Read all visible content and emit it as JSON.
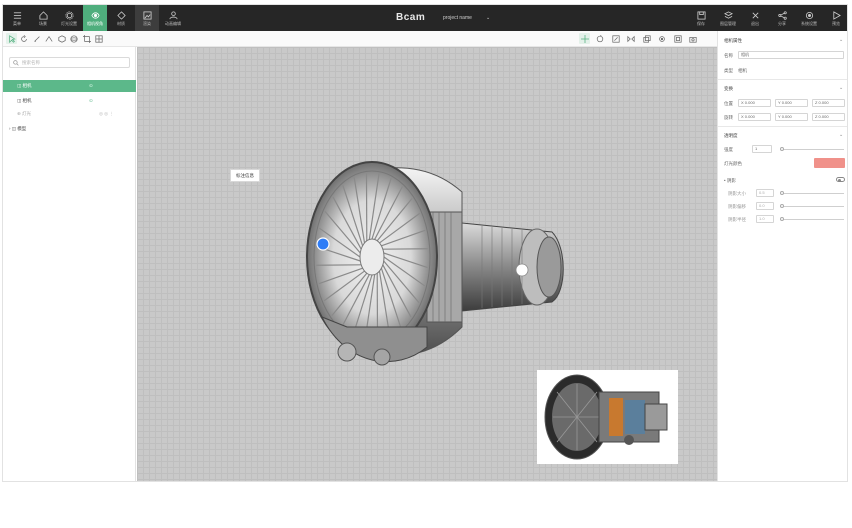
{
  "topbar": {
    "left_buttons": [
      {
        "label": "菜单",
        "icon": "menu-icon"
      },
      {
        "label": "场景",
        "icon": "home-icon"
      },
      {
        "label": "灯光设置",
        "icon": "gear-icon"
      },
      {
        "label": "相机视角",
        "icon": "eye-icon",
        "active": true
      },
      {
        "label": "材质",
        "icon": "palette-icon"
      },
      {
        "label": "渲染",
        "icon": "image-icon"
      },
      {
        "label": "动画编辑",
        "icon": "user-icon"
      }
    ],
    "brand": "Bcam",
    "project_name": "project name",
    "project_caret": "⌄",
    "right_buttons": [
      {
        "label": "保存",
        "icon": "save-icon"
      },
      {
        "label": "图层管理",
        "icon": "layers-icon"
      },
      {
        "label": "退出",
        "icon": "cross-icon"
      },
      {
        "label": "分享",
        "icon": "share-icon"
      },
      {
        "label": "系统设置",
        "icon": "settings-icon"
      },
      {
        "label": "预览",
        "icon": "play-icon"
      }
    ]
  },
  "toolbar": {
    "left_tools": [
      "select-icon",
      "rotate-icon",
      "pen-icon",
      "measure-icon",
      "box-icon",
      "sphere-icon",
      "crop-icon",
      "grid-icon"
    ],
    "right_tools": [
      "move-icon",
      "rotate-tool-icon",
      "scale-icon",
      "mirror-icon",
      "copy-icon",
      "settings-tool-icon",
      "frame-icon",
      "camera-icon"
    ]
  },
  "left_panel": {
    "search_placeholder": "搜索名称",
    "tree": [
      {
        "label": "◫ 相机",
        "eye": "⊙",
        "selected": true
      },
      {
        "label": "◫ 相机",
        "eye": "⊙",
        "selected": false
      },
      {
        "label": "⊕ 灯光",
        "eye": "◎ ◎ ⋮",
        "selected": false,
        "muted": true
      },
      {
        "label": "›  ◫ 模型",
        "eye": "",
        "selected": false
      }
    ]
  },
  "canvas": {
    "label_tag": "标注信息"
  },
  "right_panel": {
    "sections": [
      {
        "title": "相机属性",
        "caret": "⌄"
      },
      {
        "title": "变换",
        "caret": "⌄"
      },
      {
        "title": "透明度",
        "caret": "⌄"
      }
    ],
    "name_label": "名称",
    "name_value": "相机",
    "type_label": "类型",
    "type_value": "相机",
    "position_label": "位置",
    "rotation_label": "旋转",
    "pos_fields": [
      "X 0.000",
      "Y 0.000",
      "Z 0.000"
    ],
    "rot_fields": [
      "X 0.000",
      "Y 0.000",
      "Z 0.000"
    ],
    "opacity_label": "强度",
    "opacity_value": "1",
    "color_label": "灯光颜色",
    "color_hex": "#f0918a",
    "toggle_label": "• 阴影",
    "shadow_rows": [
      {
        "label": "阴影大小",
        "value": "0.5"
      },
      {
        "label": "阴影偏移",
        "value": "0.0"
      },
      {
        "label": "阴影半径",
        "value": "1.0"
      }
    ]
  },
  "colors": {
    "accent": "#4fae7d",
    "topbar_bg": "#262626",
    "canvas_bg": "#c9c9c9"
  }
}
